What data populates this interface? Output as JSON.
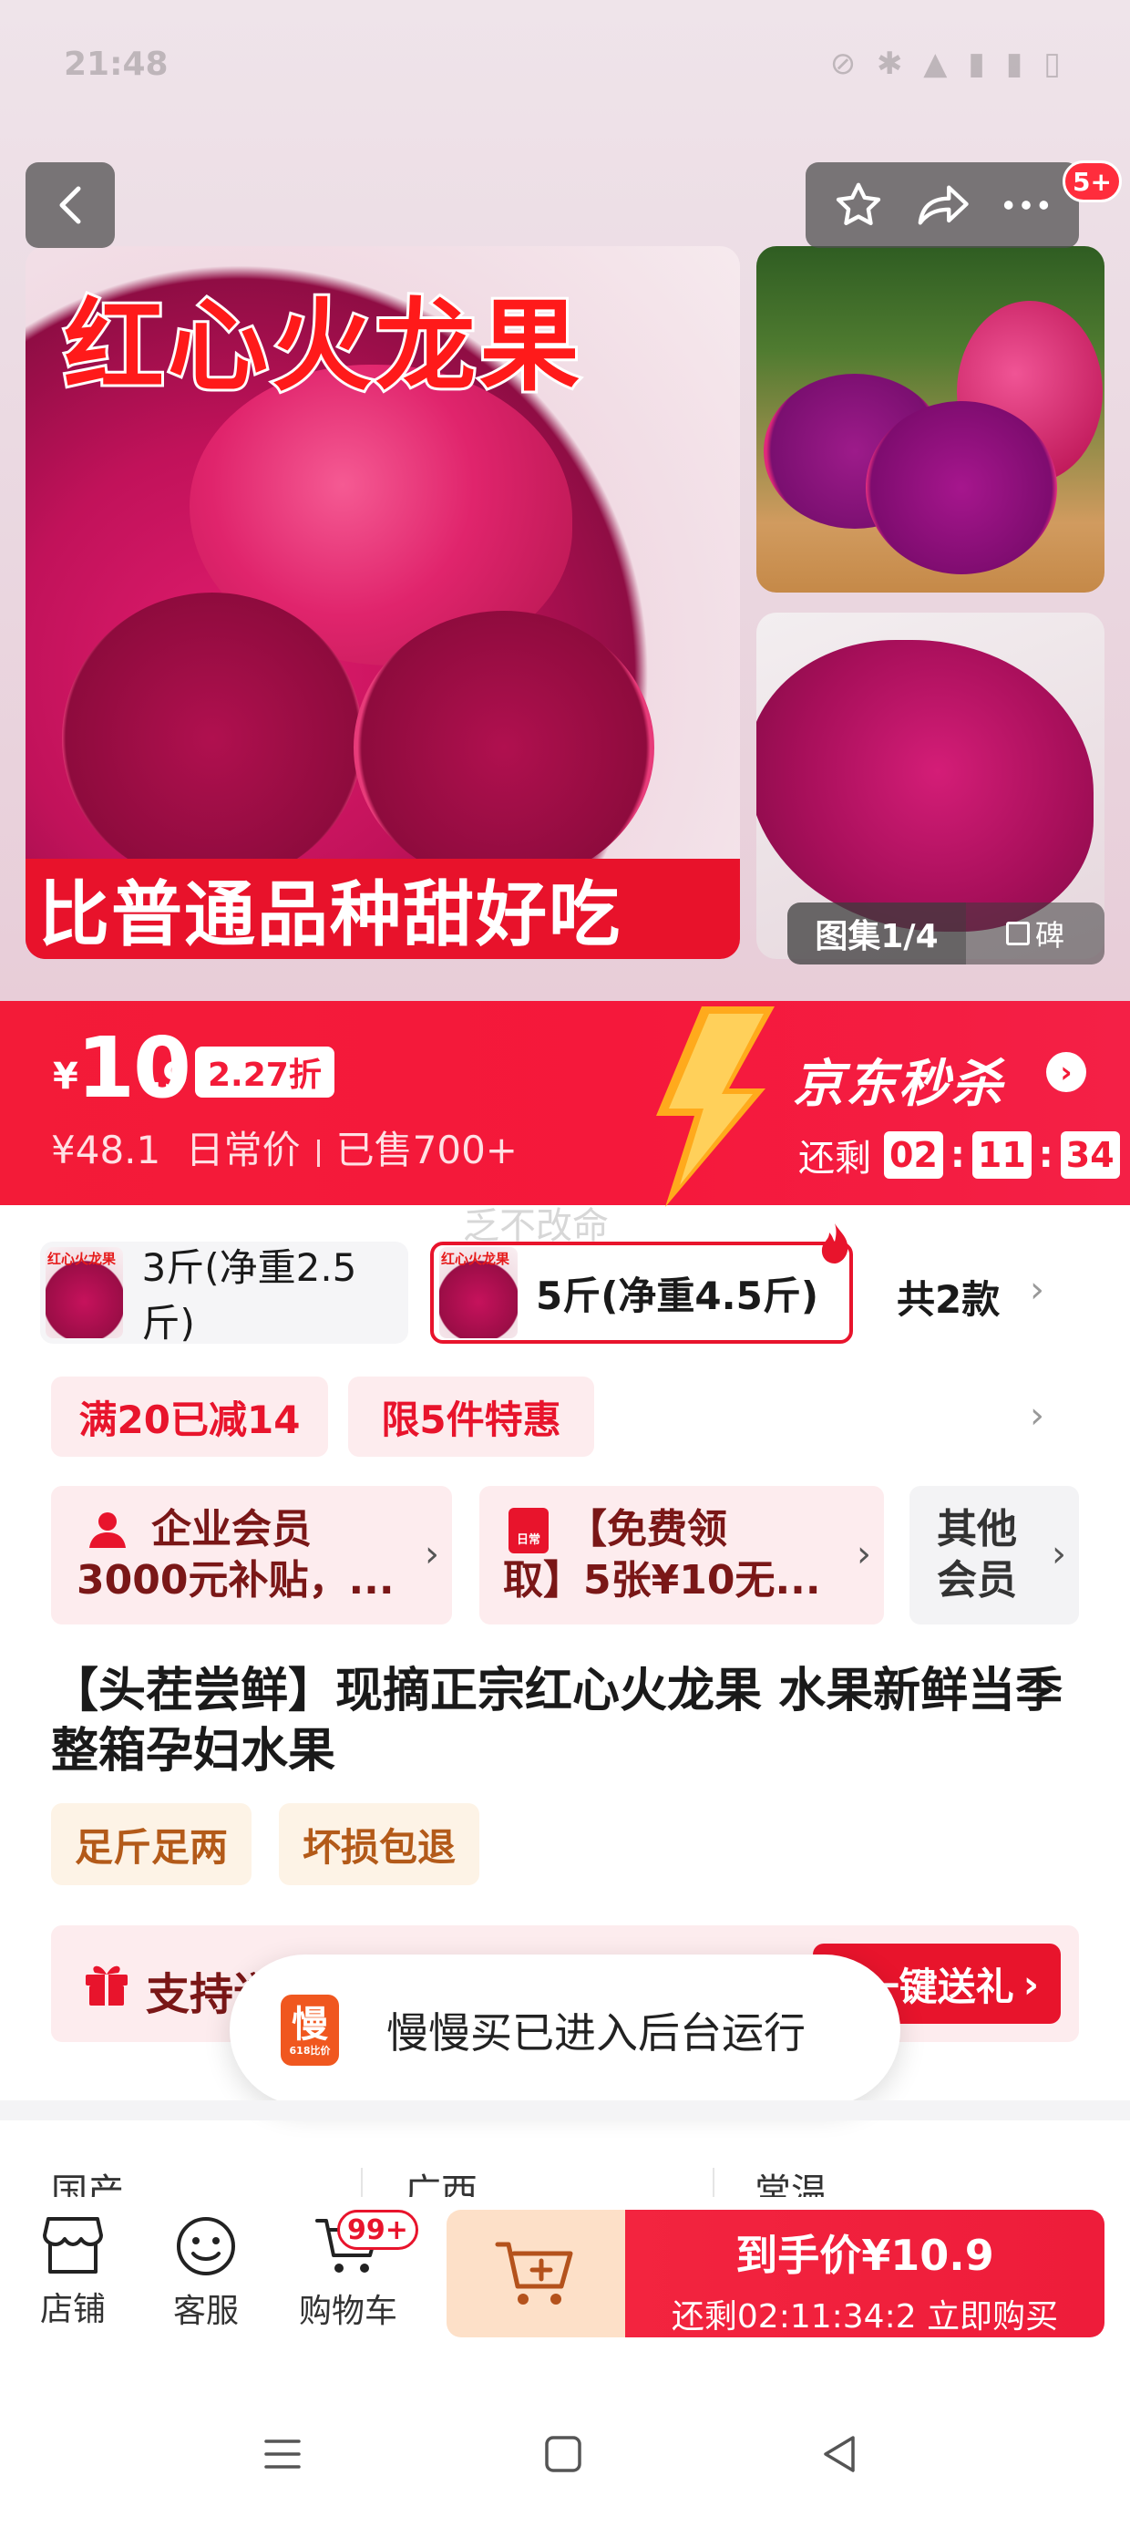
{
  "status_bar": {
    "time": "21:48",
    "icons": "⊘ ✱ ▲ ▮ ▮ ▯"
  },
  "gallery": {
    "main_title": "红心火龙果",
    "main_caption": "比普通品种甜好吃",
    "counter": "图集1/4",
    "extra_label": "碑",
    "notif_count": "5+"
  },
  "price": {
    "currency": "¥",
    "integer": "10",
    "decimal": ".9",
    "discount": "2.27折",
    "original": "¥48.1",
    "original_label": "日常价",
    "sold": "已售700+",
    "seckill_title": "京东秒杀",
    "countdown_label": "还剩",
    "countdown": [
      "02",
      "11",
      "34"
    ]
  },
  "watermark": "乏不改命",
  "sku": {
    "thumb_text": "红心火龙果",
    "option1": "3斤(净重2.5斤)",
    "option2": "5斤(净重4.5斤)",
    "count": "共2款"
  },
  "promos": [
    "满20已减14",
    "限5件特惠"
  ],
  "members": {
    "card1_line1": "企业会员",
    "card1_line2": "3000元补贴，...",
    "card2_icon": "日常",
    "card2_line1": "【免费领",
    "card2_line2": "取】5张¥10无...",
    "card3_line1": "其他",
    "card3_line2": "会员"
  },
  "product": {
    "title": "【头茬尝鲜】现摘正宗红心火龙果 水果新鲜当季整箱孕妇水果",
    "tags": [
      "足斤足两",
      "坏损包退"
    ]
  },
  "gift": {
    "text": "支持送",
    "button": "一键送礼"
  },
  "toast": {
    "app_logo": "慢",
    "app_logo_sub": "618比价",
    "message": "慢慢买已进入后台运行"
  },
  "attributes": [
    "国产",
    "广西",
    "常温"
  ],
  "bottom_bar": {
    "store": "店铺",
    "service": "客服",
    "cart": "购物车",
    "cart_badge": "99+",
    "buy_line1": "到手价¥10.9",
    "buy_line2": "还剩02:11:34:2  立即购买"
  },
  "colors": {
    "brand_red": "#e8142c",
    "seckill_red": "#f31b38",
    "tag_orange": "#b35a19"
  }
}
